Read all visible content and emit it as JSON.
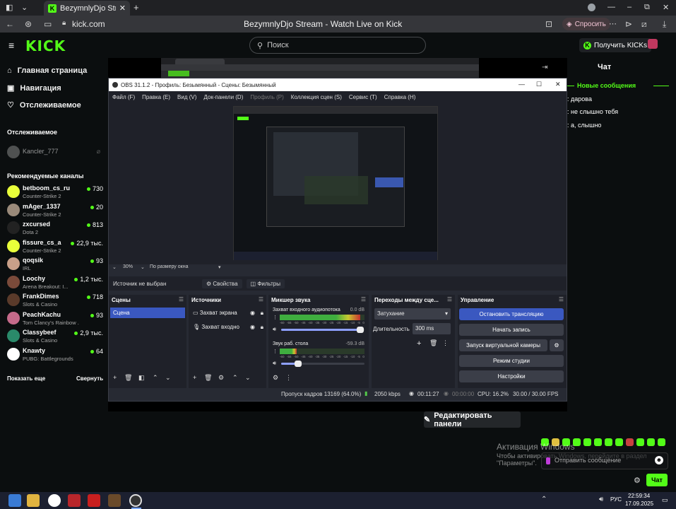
{
  "browser": {
    "tab_title": "BezymnlyDjo Stream - W",
    "url": "kick.com",
    "page_title": "BezymnlyDjo Stream - Watch Live on Kick",
    "ask_label": "Спросить"
  },
  "kick": {
    "logo": "KICK",
    "search_placeholder": "Поиск",
    "get_kicks": "Получить KICKs",
    "nav": [
      "Главная страница",
      "Навигация",
      "Отслеживаемое"
    ],
    "followed_heading": "Отслеживаемое",
    "followed_channel": "Kancler_777",
    "recommended_heading": "Рекомендуемые каналы",
    "channels": [
      {
        "name": "betboom_cs_ru",
        "game": "Counter-Strike 2",
        "viewers": "730",
        "color": "#e9ff3a"
      },
      {
        "name": "mAger_1337",
        "game": "Counter-Strike 2",
        "viewers": "20",
        "color": "#9a8a7a"
      },
      {
        "name": "zxcursed",
        "game": "Dota 2",
        "viewers": "813",
        "color": "#222222"
      },
      {
        "name": "fissure_cs_a",
        "game": "Counter-Strike 2",
        "viewers": "22,9 тыс.",
        "color": "#e9ff3a"
      },
      {
        "name": "qoqsik",
        "game": "IRL",
        "viewers": "93",
        "color": "#c9a089"
      },
      {
        "name": "Loochy",
        "game": "Arena Breakout: I...",
        "viewers": "1,2 тыс.",
        "color": "#7a4a3a"
      },
      {
        "name": "FrankDimes",
        "game": "Slots & Casino",
        "viewers": "718",
        "color": "#5a3a2a"
      },
      {
        "name": "PeachKachu",
        "game": "Tom Clancy's Rainbow ...",
        "viewers": "93",
        "color": "#c56a8a"
      },
      {
        "name": "Classybeef",
        "game": "Slots & Casino",
        "viewers": "2,9 тыс.",
        "color": "#2a8a6a"
      },
      {
        "name": "Knawty",
        "game": "PUBG: Battlegrounds",
        "viewers": "64",
        "color": "#ffffff"
      }
    ],
    "show_more": "Показать еще",
    "collapse": "Свернуть",
    "chat_title": "Чат",
    "new_messages": "Новые сообщения",
    "messages": [
      ": дарова",
      ": не слышно тебя",
      ": а, слышно"
    ],
    "send_placeholder": "Отправить сообщение",
    "chat_button": "Чат",
    "edit_panels": "Редактировать панели",
    "activation_title": "Активация Windows",
    "activation_text": "Чтобы активировать Windows, перейдите в раздел \"Параметры\"."
  },
  "obs": {
    "title": "OBS 31.1.2 - Профиль: Безымянный - Сцены: Безымянный",
    "menu": [
      "Файл (F)",
      "Правка (E)",
      "Вид (V)",
      "Док-панели (D)",
      "Профиль (P)",
      "Коллекция сцен (S)",
      "Сервис (T)",
      "Справка (H)"
    ],
    "zoom": "30%",
    "fit": "По размеру окна",
    "no_source": "Источник не выбран",
    "properties": "Свойства",
    "filters": "Фильтры",
    "scenes_title": "Сцены",
    "scene": "Сцена",
    "sources_title": "Источники",
    "sources": [
      "Захват экрана",
      "Захват входно"
    ],
    "mixer_title": "Микшер звука",
    "mixer": [
      {
        "name": "Захват входного аудиопотока",
        "db": "0.0 dB",
        "level": 0.95
      },
      {
        "name": "Звук раб. стола",
        "db": "-59.3 dB",
        "level": 0.2
      }
    ],
    "meter_ticks": [
      "-60",
      "-55",
      "-50",
      "-45",
      "-40",
      "-35",
      "-30",
      "-25",
      "-20",
      "-15",
      "-10",
      "-5",
      "0"
    ],
    "transitions_title": "Переходы между сце...",
    "transition": "Затухание",
    "duration_label": "Длительность",
    "duration": "300 ms",
    "controls_title": "Управление",
    "controls": [
      "Остановить трансляцию",
      "Начать запись",
      "Запуск виртуальной камеры",
      "Режим студии",
      "Настройки"
    ],
    "status": {
      "dropped": "Пропуск кадров 13169 (64.0%)",
      "bitrate": "2050 kbps",
      "stream_time": "00:11:27",
      "rec_time": "00:00:00",
      "cpu": "CPU: 16.2%",
      "fps": "30.00 / 30.00 FPS"
    }
  },
  "taskbar": {
    "lang": "РУС",
    "time": "22:59:34",
    "date": "17.09.2025"
  }
}
